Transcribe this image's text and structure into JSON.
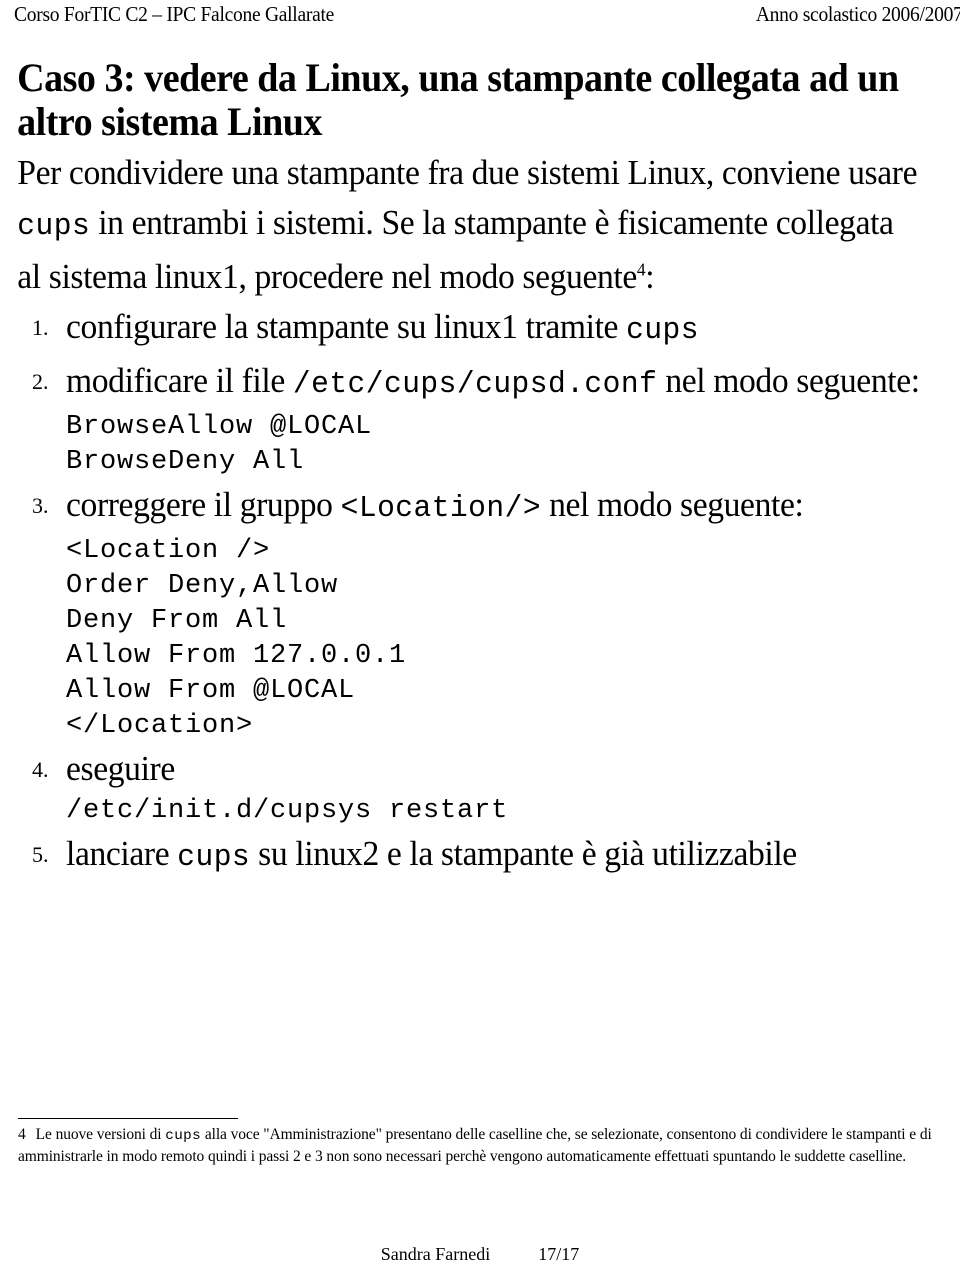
{
  "header": {
    "left": "Corso ForTIC C2 – IPC Falcone Gallarate",
    "right": "Anno scolastico 2006/2007"
  },
  "title": "Caso 3: vedere da Linux, una stampante collegata ad un altro sistema Linux",
  "lead": {
    "part1": "Per condividere una stampante fra due sistemi Linux, conviene usare ",
    "code1": "cups",
    "part2": " in entrambi i sistemi. Se la stampante è fisicamente collegata al sistema linux1, procedere nel modo seguente",
    "footnote_marker": "4",
    "part3": ":"
  },
  "steps": [
    {
      "number": "1",
      "text_before": "configurare la stampante su linux1 tramite ",
      "code": "cups",
      "text_after": ""
    },
    {
      "number": "2",
      "text_before": "modificare il file ",
      "code": "/etc/cups/cupsd.conf",
      "text_after": " nel modo seguente:",
      "code_block": [
        "BrowseAllow @LOCAL",
        "BrowseDeny All"
      ]
    },
    {
      "number": "3",
      "text_before": "correggere il gruppo ",
      "code": "<Location/>",
      "text_after": " nel modo seguente:",
      "code_block": [
        "<Location />",
        "Order Deny,Allow",
        "Deny From All",
        "Allow From 127.0.0.1",
        "Allow From @LOCAL",
        "</Location>"
      ]
    },
    {
      "number": "4",
      "text_before": "eseguire",
      "code": "",
      "text_after": "",
      "code_block": [
        "/etc/init.d/cupsys restart"
      ]
    },
    {
      "number": "5",
      "text_before": "lanciare ",
      "code": "cups",
      "text_after": " su linux2 e la stampante è già utilizzabile"
    }
  ],
  "footnote": {
    "marker": "4",
    "text_before": "Le nuove versioni di ",
    "code": "cups",
    "text_after": " alla voce \"Amministrazione\"  presentano delle caselline che, se selezionate, consentono di condividere le stampanti  e di  amministrarle in modo remoto quindi i passi 2 e 3 non sono necessari perchè vengono automaticamente effettuati spuntando  le suddette caselline."
  },
  "page_footer": {
    "author": "Sandra Farnedi",
    "page": "17/17"
  }
}
